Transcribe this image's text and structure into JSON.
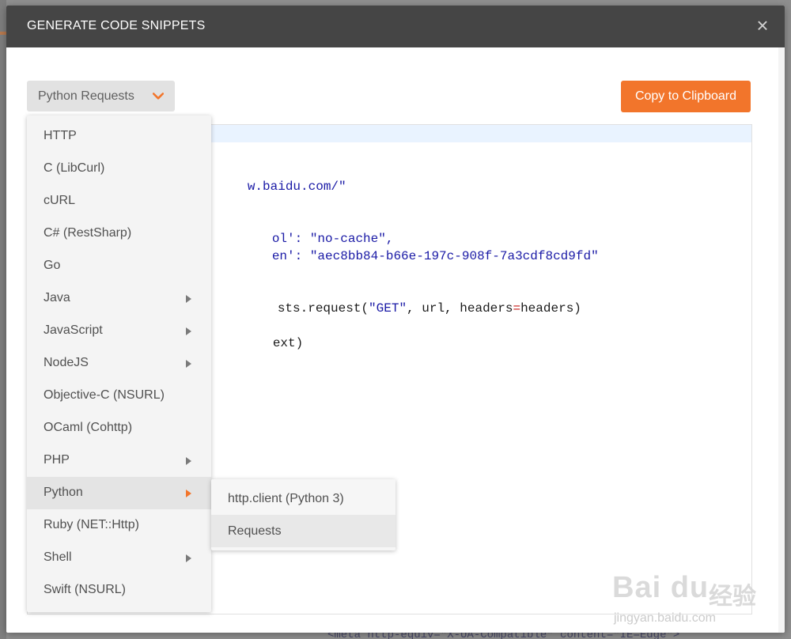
{
  "modal": {
    "title": "GENERATE CODE SNIPPETS",
    "close_glyph": "×"
  },
  "language_select": {
    "value": "Python Requests"
  },
  "copy_button": {
    "label": "Copy to Clipboard",
    "color": "#f2752b"
  },
  "code_visible": {
    "line1": "w.baidu.com/\"",
    "line2a": "ol': ",
    "line2b": "\"no-cache\",",
    "line3a": "en': ",
    "line3b": "\"aec8bb84-b66e-197c-908f-7a3cdf8cd9fd\"",
    "line4a": "sts.request(",
    "line4b": "\"GET\"",
    "line4c": ", url, headers",
    "line4d": "=",
    "line4e": "headers)",
    "line5": "ext)"
  },
  "language_menu": {
    "items": [
      {
        "label": "HTTP",
        "has_submenu": false
      },
      {
        "label": "C (LibCurl)",
        "has_submenu": false
      },
      {
        "label": "cURL",
        "has_submenu": false
      },
      {
        "label": "C# (RestSharp)",
        "has_submenu": false
      },
      {
        "label": "Go",
        "has_submenu": false
      },
      {
        "label": "Java",
        "has_submenu": true
      },
      {
        "label": "JavaScript",
        "has_submenu": true
      },
      {
        "label": "NodeJS",
        "has_submenu": true
      },
      {
        "label": "Objective-C (NSURL)",
        "has_submenu": false
      },
      {
        "label": "OCaml (Cohttp)",
        "has_submenu": false
      },
      {
        "label": "PHP",
        "has_submenu": true
      },
      {
        "label": "Python",
        "has_submenu": true,
        "active": true
      },
      {
        "label": "Ruby (NET::Http)",
        "has_submenu": false
      },
      {
        "label": "Shell",
        "has_submenu": true
      },
      {
        "label": "Swift (NSURL)",
        "has_submenu": false
      }
    ]
  },
  "python_submenu": {
    "items": [
      {
        "label": "http.client (Python 3)"
      },
      {
        "label": "Requests",
        "active": true
      }
    ]
  },
  "background": {
    "bottom_code_text": "<meta http-equiv=\"X-UA-Compatible\" content=\"IE=Edge\">"
  },
  "watermark": {
    "logo": "Bai du",
    "cn": "经验",
    "url": "jingyan.baidu.com"
  },
  "icons": {
    "select_chevron": "chevron-down-icon",
    "submenu_arrow": "chevron-right-icon"
  }
}
